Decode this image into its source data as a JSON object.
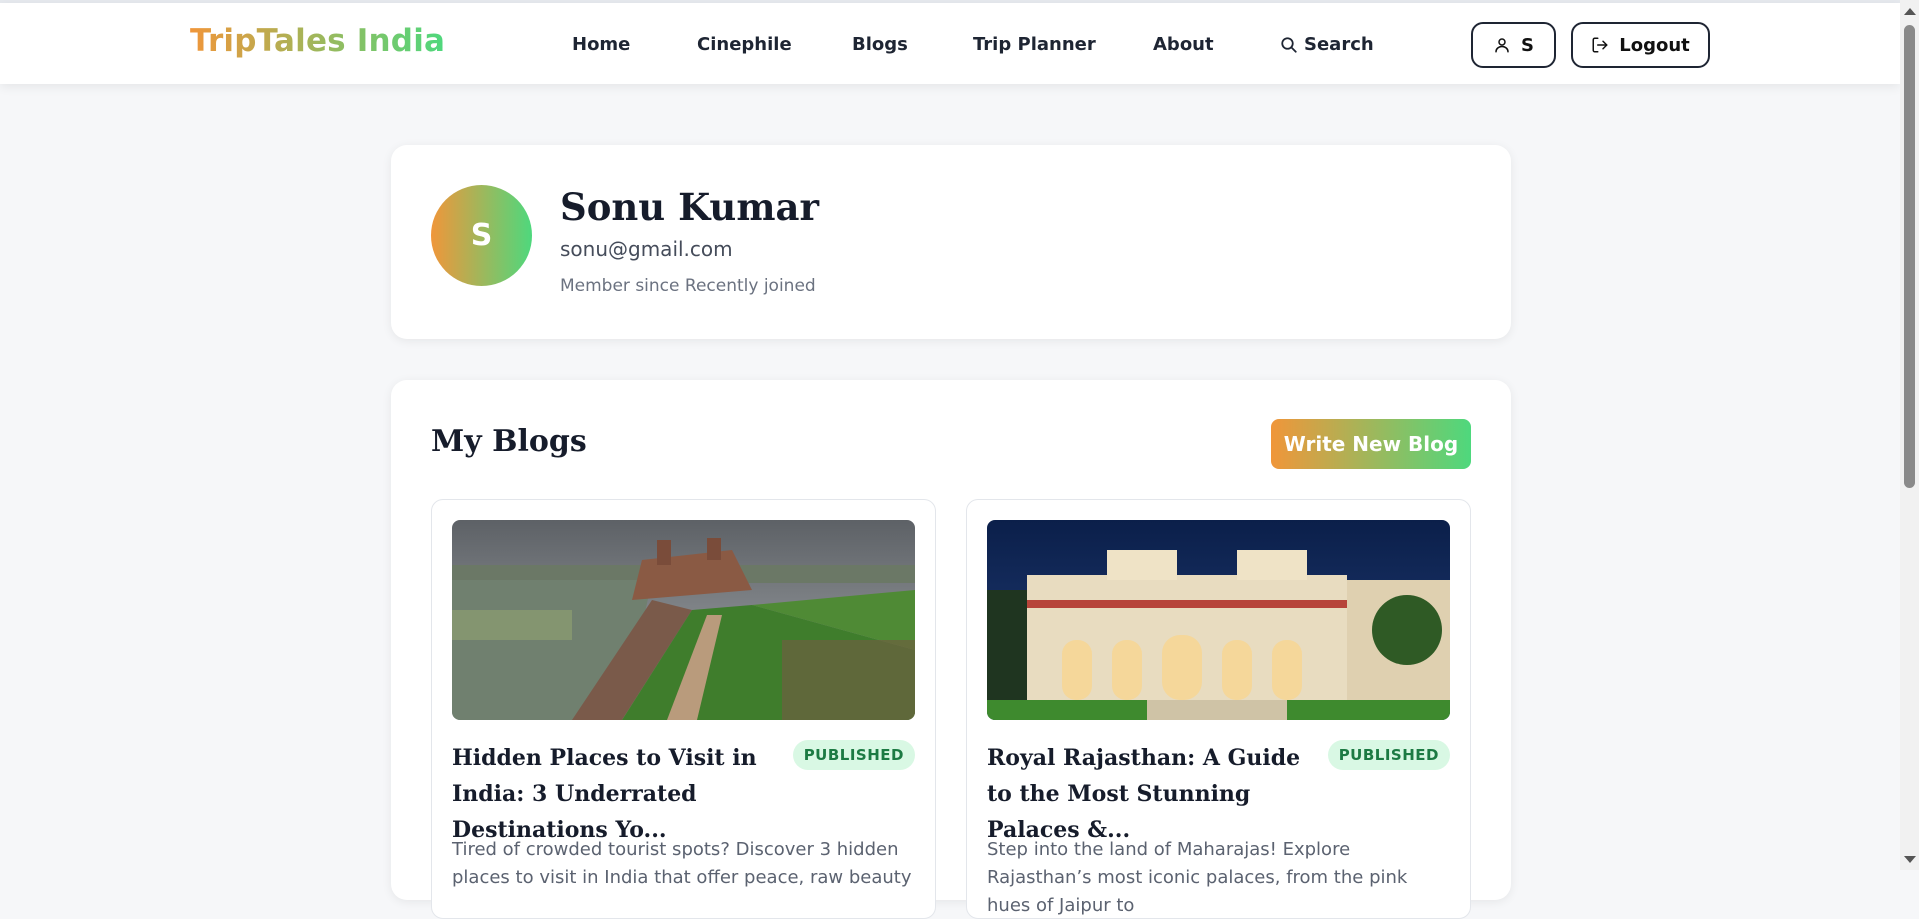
{
  "brand": {
    "name": "TripTales India"
  },
  "nav": {
    "home": "Home",
    "cinephile": "Cinephile",
    "blogs": "Blogs",
    "trip_planner": "Trip Planner",
    "about": "About",
    "search": "Search"
  },
  "header_actions": {
    "user_initial": "S",
    "logout": "Logout"
  },
  "profile": {
    "initial": "S",
    "name": "Sonu Kumar",
    "email": "sonu@gmail.com",
    "member_since": "Member since Recently joined"
  },
  "blogs_section": {
    "title": "My Blogs",
    "write_button": "Write New Blog",
    "items": [
      {
        "title": "Hidden Places to Visit in India: 3 Underrated Destinations Yo...",
        "status": "PUBLISHED",
        "excerpt": "Tired of crowded tourist spots? Discover 3 hidden places to visit in India that offer peace, raw beauty"
      },
      {
        "title": "Royal Rajasthan: A Guide to the Most Stunning Palaces &...",
        "status": "PUBLISHED",
        "excerpt": "Step into the land of Maharajas! Explore Rajasthan’s most iconic palaces, from the pink hues of Jaipur to"
      }
    ]
  },
  "colors": {
    "gradient_start": "#f0963a",
    "gradient_end": "#4ed87d",
    "badge_bg": "#d9f8e4",
    "badge_text": "#1c7a43"
  }
}
